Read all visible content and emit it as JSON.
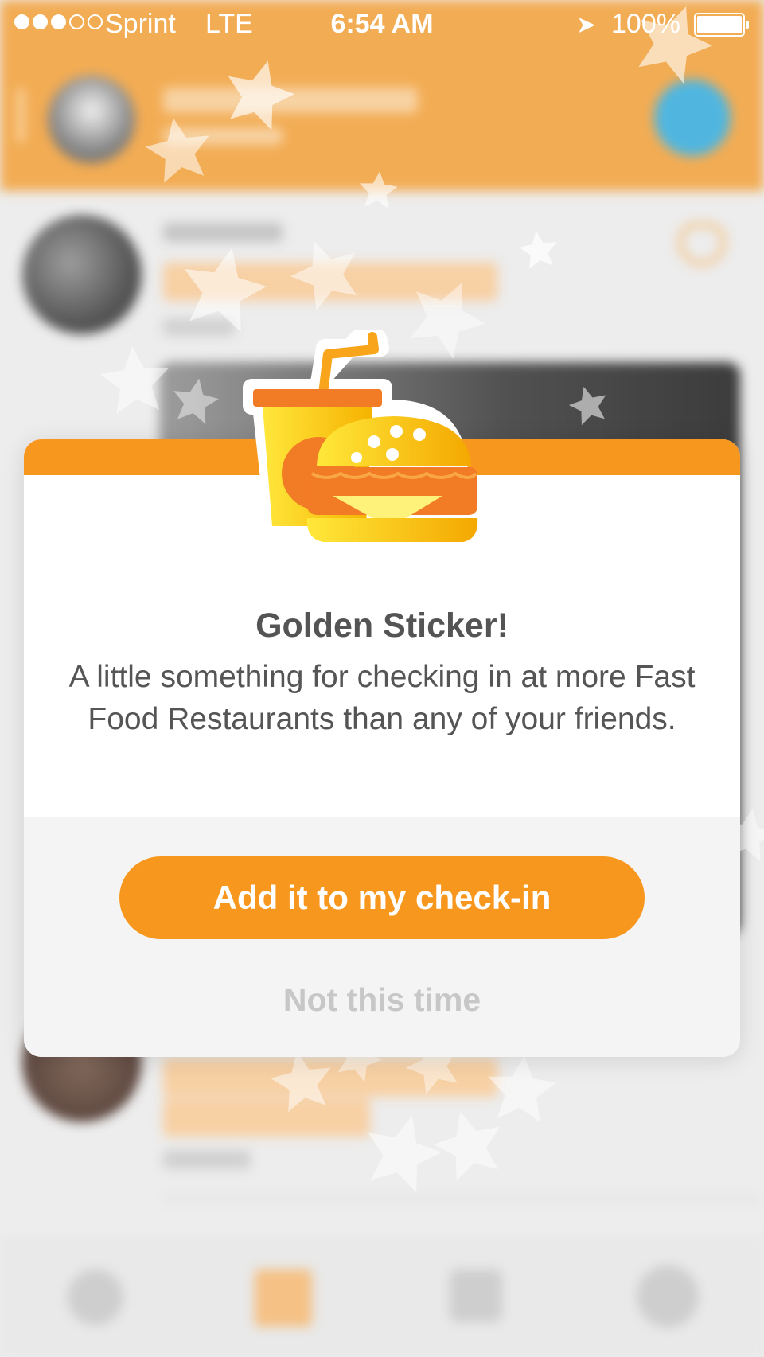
{
  "status_bar": {
    "carrier": "Sprint",
    "network": "LTE",
    "time": "6:54 AM",
    "battery": "100%",
    "signal_bars_filled": 3,
    "signal_bars_total": 5
  },
  "modal": {
    "sticker_icon": "fast-food-sticker-icon",
    "title": "Golden Sticker!",
    "description": "A little something for checking in at more Fast Food Restaurants than any of your friends.",
    "primary_button": "Add it to my check-in",
    "secondary_button": "Not this time"
  },
  "colors": {
    "accent": "#f8971e",
    "header_bg": "#f09a2e",
    "title_text": "#545454",
    "secondary_text": "#c7c7c7",
    "check_badge": "#2aa6d9"
  },
  "icons": {
    "tab_1": "gear-icon",
    "tab_2": "grid-icon",
    "tab_3": "calendar-icon",
    "tab_4": "profile-icon",
    "header_badge": "checkmark-icon",
    "post_action": "heart-icon"
  }
}
